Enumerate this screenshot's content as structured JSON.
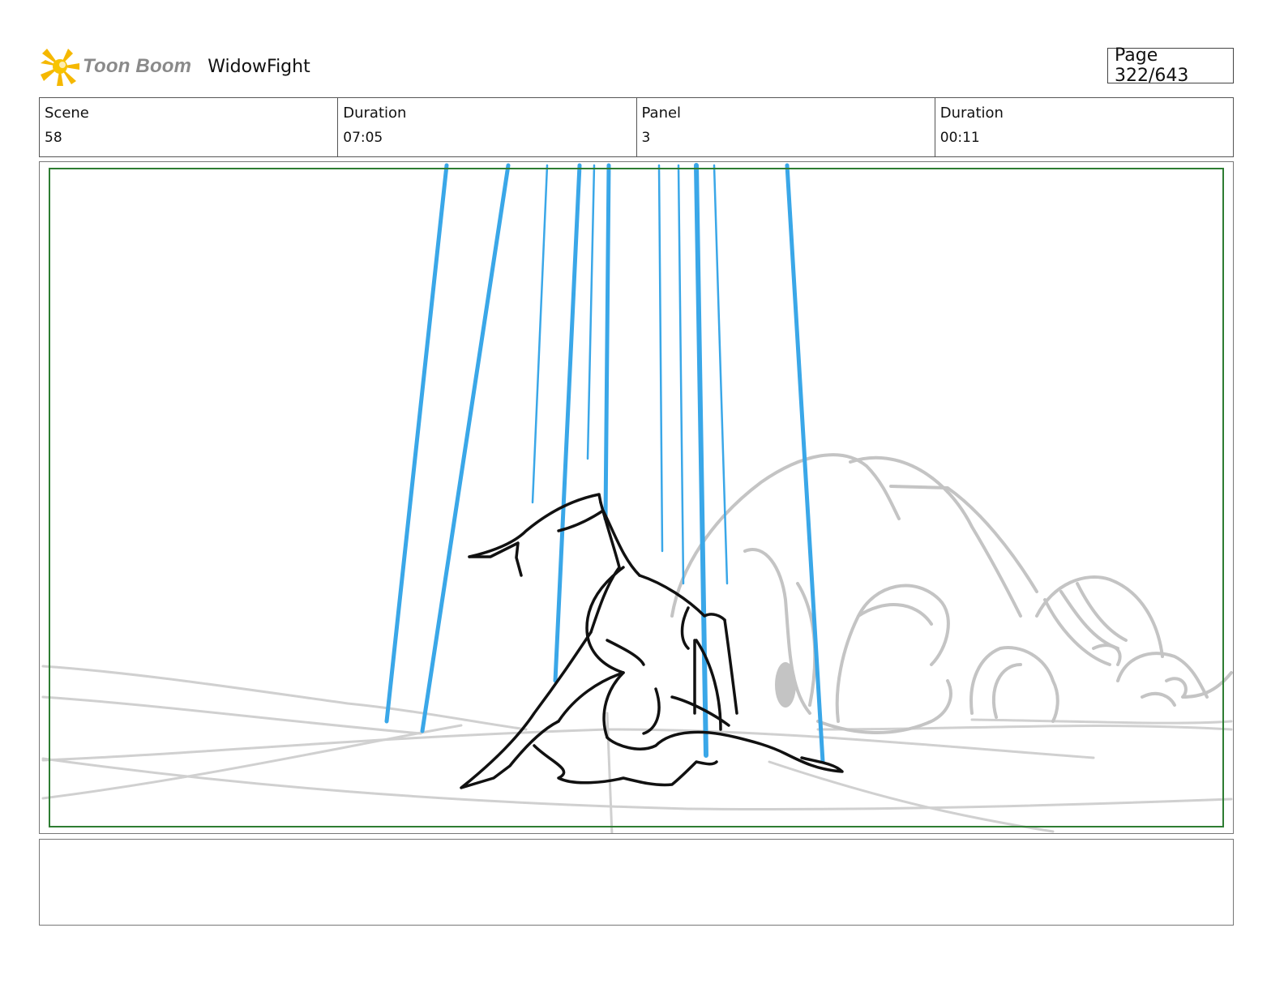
{
  "header": {
    "logo_text": "Toon Boom",
    "project_title": "WidowFight",
    "page_label": "Page 322/643"
  },
  "info": {
    "scene_label": "Scene",
    "scene_value": "58",
    "scene_duration_label": "Duration",
    "scene_duration_value": "07:05",
    "panel_label": "Panel",
    "panel_value": "3",
    "panel_duration_label": "Duration",
    "panel_duration_value": "00:11"
  },
  "colors": {
    "logo_star": "#f5b800",
    "logo_text": "#8a8a8a",
    "safe_frame": "#2e7d32",
    "light_beams": "#3aa7e8",
    "sketch_figure": "#111111",
    "background_sketch": "#c8c8c8"
  },
  "panel": {
    "drawing": "storyboard-sketch"
  },
  "notes": {
    "text": ""
  }
}
